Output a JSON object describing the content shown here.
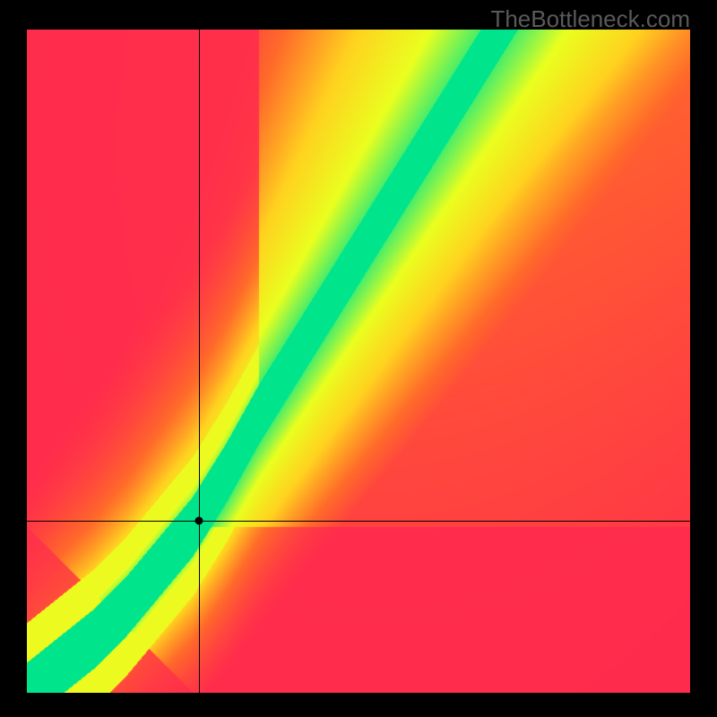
{
  "watermark": "TheBottleneck.com",
  "chart_data": {
    "type": "heatmap",
    "title": "",
    "xlabel": "",
    "ylabel": "",
    "xlim": [
      0,
      1
    ],
    "ylim": [
      0,
      1
    ],
    "grid": false,
    "marker": {
      "x": 0.26,
      "y": 0.26
    },
    "crosshair": {
      "x": 0.26,
      "y": 0.26
    },
    "color_stops": [
      {
        "t": 0.0,
        "color": "#ff2a4d"
      },
      {
        "t": 0.25,
        "color": "#ff6a2a"
      },
      {
        "t": 0.5,
        "color": "#ffd21f"
      },
      {
        "t": 0.75,
        "color": "#eaff1f"
      },
      {
        "t": 1.0,
        "color": "#00e58b"
      }
    ],
    "optimal_curve": [
      {
        "x": 0.0,
        "y": 0.0
      },
      {
        "x": 0.05,
        "y": 0.04
      },
      {
        "x": 0.1,
        "y": 0.08
      },
      {
        "x": 0.15,
        "y": 0.13
      },
      {
        "x": 0.2,
        "y": 0.19
      },
      {
        "x": 0.25,
        "y": 0.25
      },
      {
        "x": 0.3,
        "y": 0.33
      },
      {
        "x": 0.35,
        "y": 0.42
      },
      {
        "x": 0.4,
        "y": 0.5
      },
      {
        "x": 0.45,
        "y": 0.58
      },
      {
        "x": 0.5,
        "y": 0.66
      },
      {
        "x": 0.55,
        "y": 0.74
      },
      {
        "x": 0.6,
        "y": 0.82
      },
      {
        "x": 0.65,
        "y": 0.9
      },
      {
        "x": 0.7,
        "y": 0.98
      }
    ],
    "band_half_width": 0.045,
    "background_corners": {
      "bottom_left": "#ff2a4d",
      "bottom_right": "#ff2a4d",
      "top_left": "#ff2a4d",
      "top_right": "#ffe53b"
    }
  }
}
